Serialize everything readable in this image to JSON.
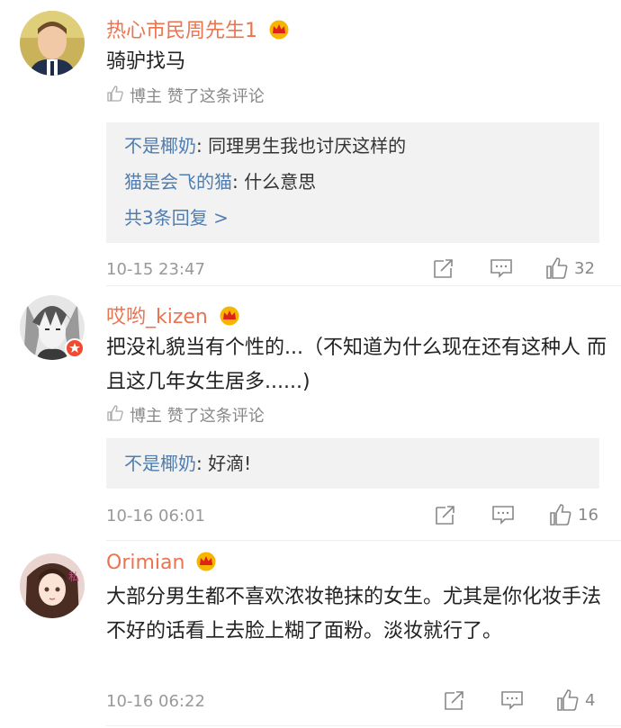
{
  "comments": [
    {
      "username": "热心市民周先生1",
      "text": "骑驴找马",
      "like_note": "博主 赞了这条评论",
      "replies": [
        {
          "name": "不是椰奶",
          "text": ": 同理男生我也讨厌这样的"
        },
        {
          "name": "猫是会飞的猫",
          "text": ": 什么意思"
        }
      ],
      "more": "共3条回复 >",
      "time": "10-15 23:47",
      "likes": "32"
    },
    {
      "username": "哎哟_kizen",
      "text": "把没礼貌当有个性的...（不知道为什么现在还有这种人 而且这几年女生居多......)",
      "like_note": "博主 赞了这条评论",
      "replies": [
        {
          "name": "不是椰奶",
          "text": ": 好滴!"
        }
      ],
      "time": "10-16 06:01",
      "likes": "16"
    },
    {
      "username": "Orimian",
      "text": "大部分男生都不喜欢浓妆艳抹的女生。尤其是你化妆手法不好的话看上去脸上糊了面粉。淡妆就行了。",
      "time": "10-16 06:22",
      "likes": "4"
    }
  ],
  "colors": {
    "username": "#eb7350",
    "link": "#507daf",
    "reply_bg": "#f2f2f2"
  }
}
